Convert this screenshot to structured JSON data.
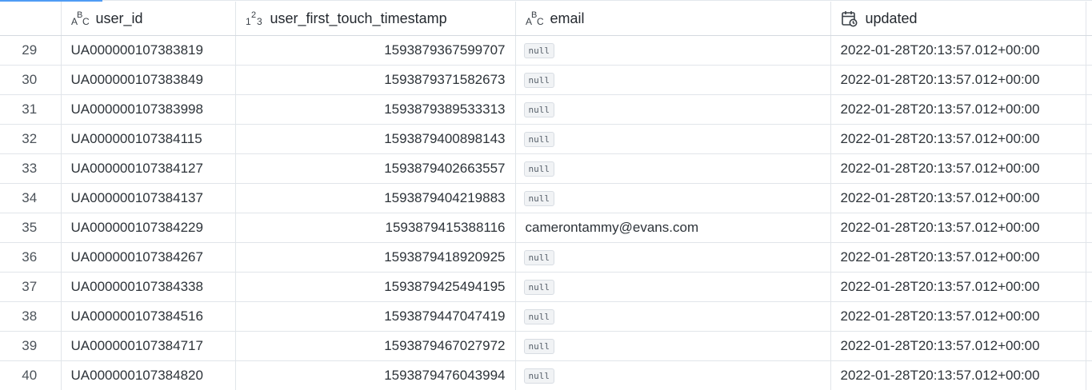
{
  "table": {
    "columns": [
      {
        "key": "row_number",
        "label": "",
        "icon": ""
      },
      {
        "key": "user_id",
        "label": "user_id",
        "icon": "string-type-icon"
      },
      {
        "key": "user_first_touch_timestamp",
        "label": "user_first_touch_timestamp",
        "icon": "number-type-icon"
      },
      {
        "key": "email",
        "label": "email",
        "icon": "string-type-icon"
      },
      {
        "key": "updated",
        "label": "updated",
        "icon": "timestamp-type-icon"
      }
    ],
    "null_label": "null",
    "rows": [
      {
        "row_number": "29",
        "user_id": "UA000000107383819",
        "user_first_touch_timestamp": "1593879367599707",
        "email": null,
        "updated": "2022-01-28T20:13:57.012+00:00"
      },
      {
        "row_number": "30",
        "user_id": "UA000000107383849",
        "user_first_touch_timestamp": "1593879371582673",
        "email": null,
        "updated": "2022-01-28T20:13:57.012+00:00"
      },
      {
        "row_number": "31",
        "user_id": "UA000000107383998",
        "user_first_touch_timestamp": "1593879389533313",
        "email": null,
        "updated": "2022-01-28T20:13:57.012+00:00"
      },
      {
        "row_number": "32",
        "user_id": "UA000000107384115",
        "user_first_touch_timestamp": "1593879400898143",
        "email": null,
        "updated": "2022-01-28T20:13:57.012+00:00"
      },
      {
        "row_number": "33",
        "user_id": "UA000000107384127",
        "user_first_touch_timestamp": "1593879402663557",
        "email": null,
        "updated": "2022-01-28T20:13:57.012+00:00"
      },
      {
        "row_number": "34",
        "user_id": "UA000000107384137",
        "user_first_touch_timestamp": "1593879404219883",
        "email": null,
        "updated": "2022-01-28T20:13:57.012+00:00"
      },
      {
        "row_number": "35",
        "user_id": "UA000000107384229",
        "user_first_touch_timestamp": "1593879415388116",
        "email": "camerontammy@evans.com",
        "updated": "2022-01-28T20:13:57.012+00:00"
      },
      {
        "row_number": "36",
        "user_id": "UA000000107384267",
        "user_first_touch_timestamp": "1593879418920925",
        "email": null,
        "updated": "2022-01-28T20:13:57.012+00:00"
      },
      {
        "row_number": "37",
        "user_id": "UA000000107384338",
        "user_first_touch_timestamp": "1593879425494195",
        "email": null,
        "updated": "2022-01-28T20:13:57.012+00:00"
      },
      {
        "row_number": "38",
        "user_id": "UA000000107384516",
        "user_first_touch_timestamp": "1593879447047419",
        "email": null,
        "updated": "2022-01-28T20:13:57.012+00:00"
      },
      {
        "row_number": "39",
        "user_id": "UA000000107384717",
        "user_first_touch_timestamp": "1593879467027972",
        "email": null,
        "updated": "2022-01-28T20:13:57.012+00:00"
      },
      {
        "row_number": "40",
        "user_id": "UA000000107384820",
        "user_first_touch_timestamp": "1593879476043994",
        "email": null,
        "updated": "2022-01-28T20:13:57.012+00:00"
      }
    ]
  }
}
